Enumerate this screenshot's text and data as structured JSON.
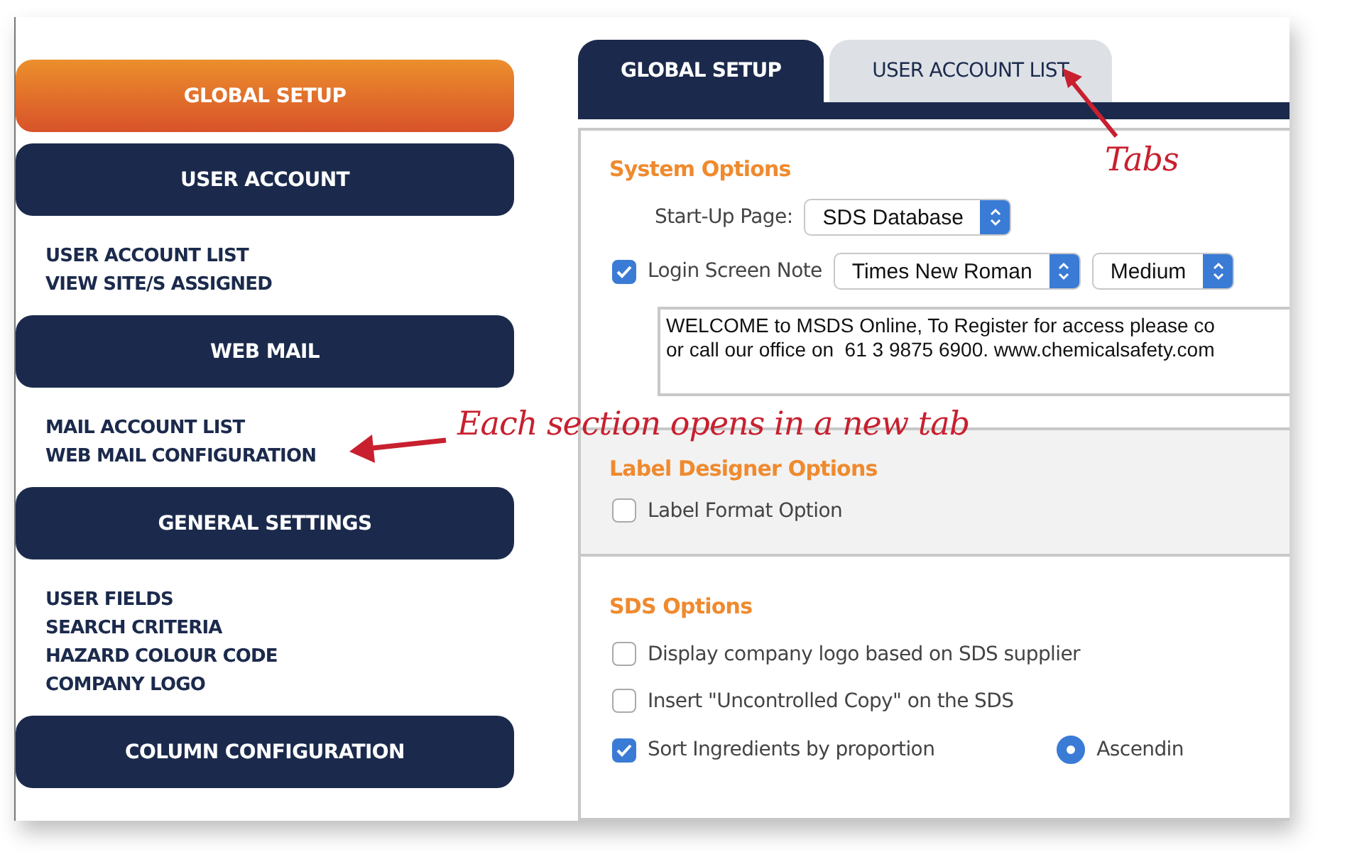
{
  "sidebar": {
    "sections": [
      {
        "title": "GLOBAL SETUP",
        "selected": true
      },
      {
        "title": "USER ACCOUNT",
        "selected": false,
        "items": [
          "USER ACCOUNT LIST",
          "VIEW SITE/S ASSIGNED"
        ]
      },
      {
        "title": "WEB MAIL",
        "selected": false,
        "items": [
          "MAIL ACCOUNT LIST",
          "WEB MAIL CONFIGURATION"
        ]
      },
      {
        "title": "GENERAL SETTINGS",
        "selected": false,
        "items": [
          "USER FIELDS",
          "SEARCH CRITERIA",
          "HAZARD COLOUR CODE",
          "COMPANY LOGO"
        ]
      },
      {
        "title": "COLUMN CONFIGURATION",
        "selected": false
      }
    ]
  },
  "tabs": [
    {
      "label": "GLOBAL SETUP",
      "selected": true
    },
    {
      "label": "USER ACCOUNT LIST",
      "selected": false
    }
  ],
  "system_options": {
    "title": "System Options",
    "start_up_page": {
      "label": "Start-Up Page:",
      "value": "SDS Database"
    },
    "login_screen_note": {
      "label": "Login Screen Note",
      "checked": true,
      "font": "Times New Roman",
      "size": "Medium",
      "note": "WELCOME to MSDS Online, To Register for access please co\nor call our office on  61 3 9875 6900. www.chemicalsafety.com"
    }
  },
  "label_designer_options": {
    "title": "Label Designer Options",
    "options": [
      {
        "label": "Label Format Option",
        "checked": false
      }
    ]
  },
  "sds_options": {
    "title": "SDS Options",
    "options": [
      {
        "label": "Display company logo based on SDS supplier",
        "checked": false
      },
      {
        "label": "Insert \"Uncontrolled Copy\" on the SDS",
        "checked": false
      },
      {
        "label": "Sort Ingredients by proportion",
        "checked": true,
        "order": {
          "label": "Ascendin",
          "selected": true
        }
      }
    ]
  },
  "annotations": [
    {
      "text": "Tabs"
    },
    {
      "text": "Each section opens in a new tab"
    }
  ]
}
